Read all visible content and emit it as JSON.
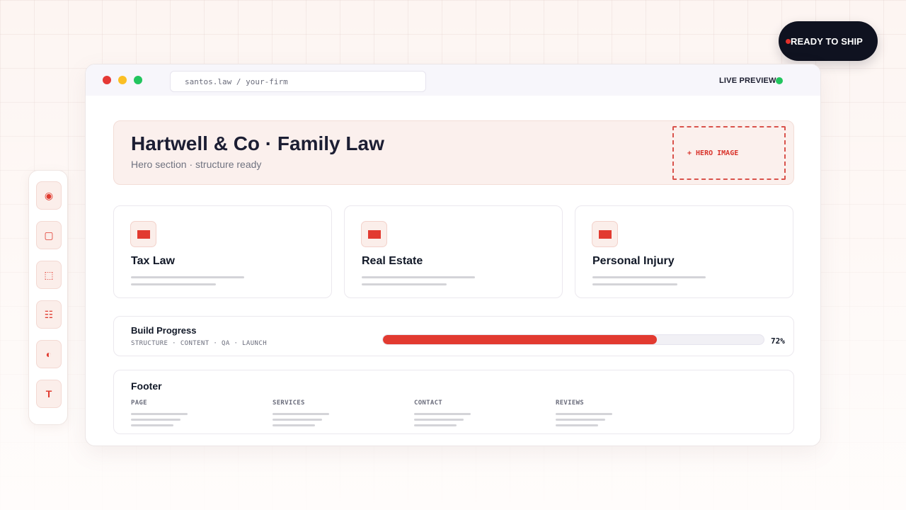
{
  "badge": {
    "label": "READY TO SHIP",
    "dot_color": "#e4312b"
  },
  "toolbar": {
    "tools": [
      {
        "icon": "target-icon",
        "glyph": "◉"
      },
      {
        "icon": "rounded-square-icon",
        "glyph": "▢"
      },
      {
        "icon": "dashed-frame-icon",
        "glyph": "⬚"
      },
      {
        "icon": "grid-list-icon",
        "glyph": "☷"
      },
      {
        "icon": "contrast-icon",
        "glyph": "◐"
      },
      {
        "icon": "text-icon",
        "glyph": "T"
      }
    ]
  },
  "window": {
    "url": "santos.law / your-firm",
    "live_label": "LIVE PREVIEW",
    "traffic_lights": [
      "#e53935",
      "#fbbf24",
      "#22c55e"
    ]
  },
  "hero": {
    "title": "Hartwell & Co · Family Law",
    "subtitle": "Hero section · structure ready",
    "image_placeholder": "+ HERO IMAGE"
  },
  "cards": [
    {
      "title": "Tax Law"
    },
    {
      "title": "Real Estate"
    },
    {
      "title": "Personal Injury"
    }
  ],
  "progress": {
    "title": "Build Progress",
    "steps": "STRUCTURE · CONTENT · QA · LAUNCH",
    "percent": 72,
    "percent_label": "72%"
  },
  "footer": {
    "title": "Footer",
    "columns": [
      "PAGE",
      "SERVICES",
      "CONTACT",
      "REVIEWS"
    ]
  },
  "colors": {
    "accent": "#e23a30",
    "dark": "#0f1220",
    "success": "#22c55e"
  }
}
